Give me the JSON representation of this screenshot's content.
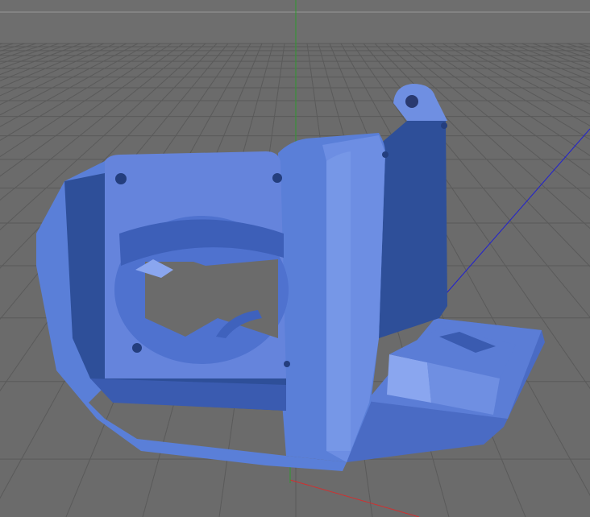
{
  "viewport": {
    "background": "#6b6b6b",
    "sky_color": "#6e6e6e",
    "grid_color": "#5a5a5a",
    "horizon_color": "#8a8a8a",
    "axis_colors": {
      "x": "#d03030",
      "y": "#2f9a2f",
      "z": "#2020d0"
    }
  },
  "model": {
    "icon": "3d-printed-part",
    "base_color": "#5a7fd8",
    "light_color": "#7c9de8",
    "dark_color": "#2e4f99",
    "deep_color": "#203e82"
  }
}
